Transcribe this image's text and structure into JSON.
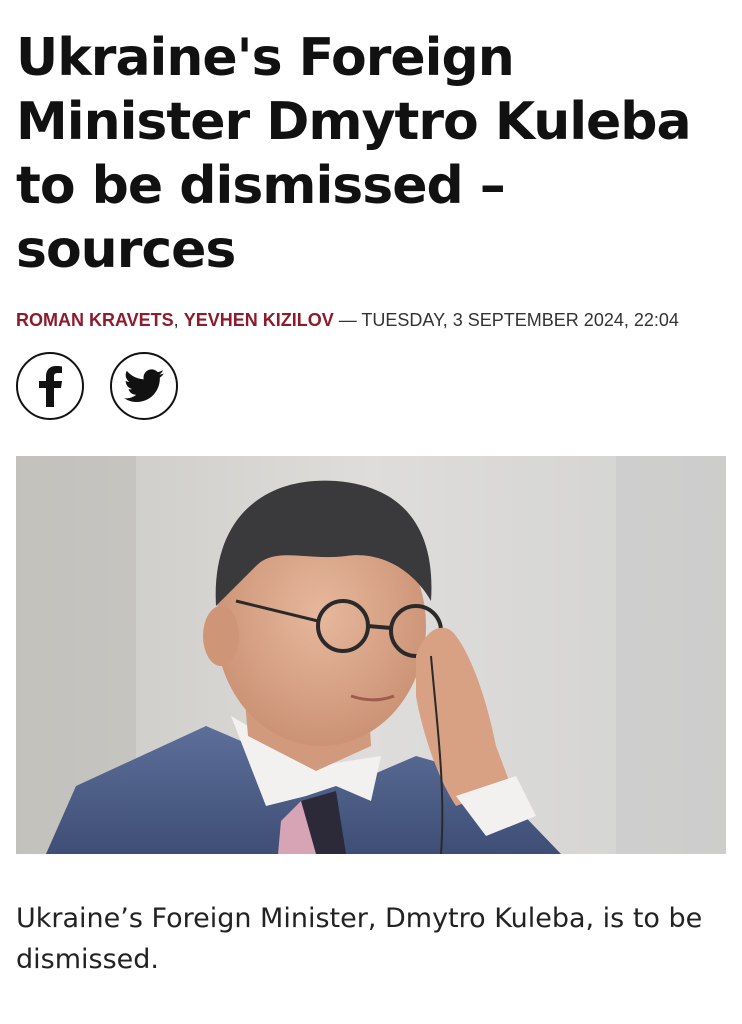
{
  "article": {
    "headline": "Ukraine's Foreign Minister Dmytro Kuleba to be dismissed – sources",
    "authors": [
      "ROMAN KRAVETS",
      "YEVHEN KIZILOV"
    ],
    "author_separator": ", ",
    "date_separator": " — ",
    "date": "TUESDAY, 3 SEPTEMBER 2024, 22:04",
    "caption": "Ukraine’s Foreign Minister, Dmytro Kuleba, is to be dismissed."
  },
  "share": {
    "facebook_icon": "facebook-icon",
    "twitter_icon": "twitter-icon"
  },
  "colors": {
    "author_link": "#8e1a2b",
    "text": "#111111"
  }
}
